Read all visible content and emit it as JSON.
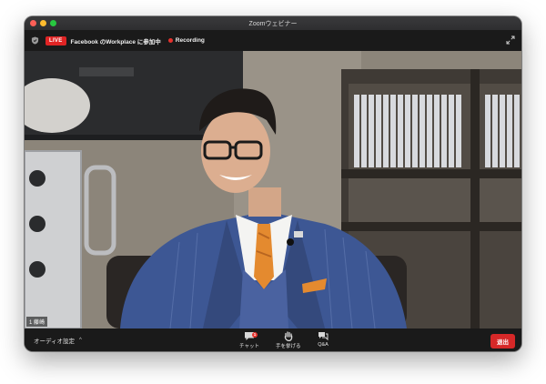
{
  "window": {
    "title": "Zoomウェビナー"
  },
  "topbar": {
    "live_label": "LIVE",
    "meeting_name": "Facebook のWorkplace に参加中",
    "recording_label": "Recording"
  },
  "video": {
    "participant_label": "1 藤崎"
  },
  "bottombar": {
    "audio_label": "オーディオ設定",
    "chat_label": "チャット",
    "chat_badge": "1",
    "raise_hand_label": "手を挙げる",
    "qa_label": "Q&A",
    "leave_label": "退出"
  },
  "colors": {
    "live": "#e02424",
    "recording_dot": "#e5322d",
    "leave_button": "#d62828",
    "suit": "#3d5794",
    "tie": "#e48a2f"
  },
  "icons": [
    "shield-icon",
    "fullscreen-icon",
    "chat-icon",
    "raise-hand-icon",
    "qa-icon",
    "caret-up-icon"
  ]
}
